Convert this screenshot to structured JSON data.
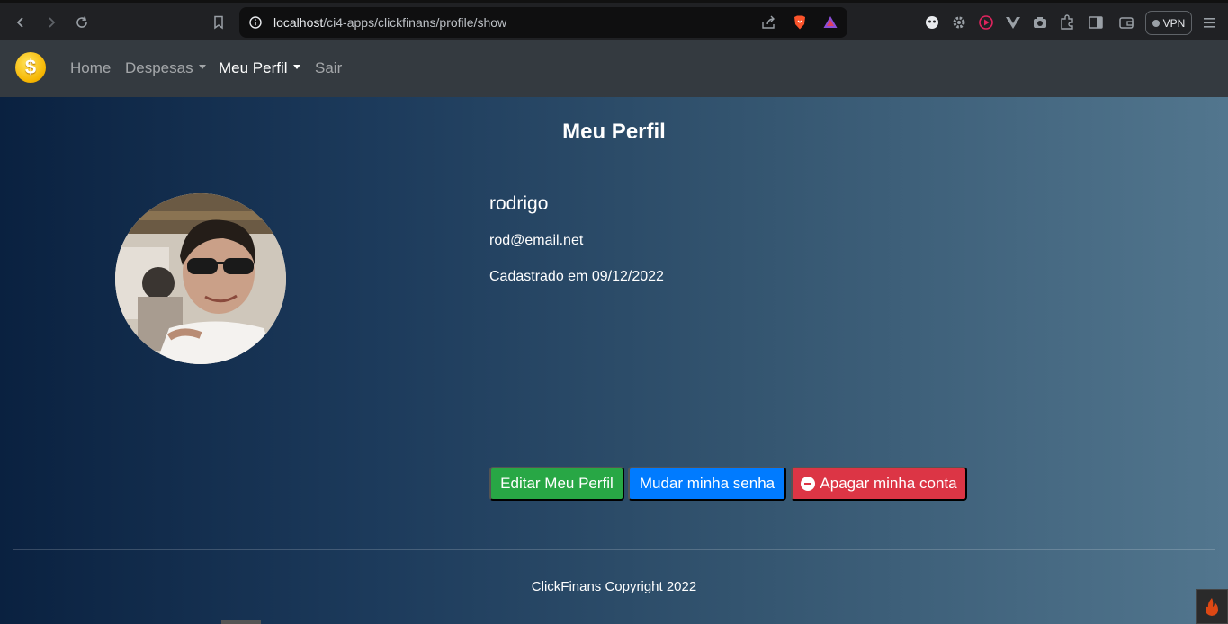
{
  "browser": {
    "url_host": "localhost",
    "url_path": "/ci4-apps/clickfinans/profile/show",
    "vpn_label": "VPN"
  },
  "navbar": {
    "brand_symbol": "$",
    "links": [
      {
        "label": "Home",
        "dropdown": false,
        "active": false
      },
      {
        "label": "Despesas",
        "dropdown": true,
        "active": false
      },
      {
        "label": "Meu Perfil",
        "dropdown": true,
        "active": true
      },
      {
        "label": "Sair",
        "dropdown": false,
        "active": false
      }
    ]
  },
  "page": {
    "title": "Meu Perfil"
  },
  "profile": {
    "username": "rodrigo",
    "email": "rod@email.net",
    "created": "Cadastrado em 09/12/2022"
  },
  "actions": {
    "edit_label": "Editar Meu Perfil",
    "password_label": "Mudar minha senha",
    "delete_label": "Apagar minha conta"
  },
  "footer": {
    "text": "ClickFinans Copyright 2022"
  },
  "colors": {
    "success": "#28a745",
    "primary": "#007bff",
    "danger": "#dc3545",
    "navbar": "#343a40"
  }
}
